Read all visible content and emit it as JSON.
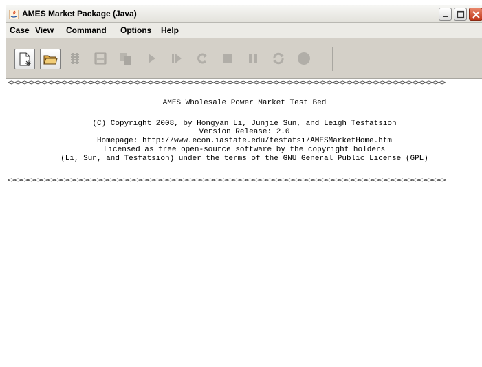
{
  "window": {
    "title": "AMES Market Package (Java)",
    "controls": {
      "minimize_icon": "minimize-icon",
      "maximize_icon": "maximize-icon",
      "close_icon": "close-icon"
    }
  },
  "menu": {
    "items": [
      {
        "accel": "C",
        "rest": "ase"
      },
      {
        "accel": "V",
        "rest": "iew"
      },
      {
        "pre": "Co",
        "accel": "m",
        "rest": "mand"
      },
      {
        "accel": "O",
        "rest": "ptions"
      },
      {
        "accel": "H",
        "rest": "elp"
      }
    ]
  },
  "toolbar": {
    "buttons": [
      {
        "icon": "new-case-icon",
        "enabled": true
      },
      {
        "icon": "open-folder-icon",
        "enabled": true
      },
      {
        "icon": "settings-icon",
        "enabled": false
      },
      {
        "icon": "save-icon",
        "enabled": false
      },
      {
        "icon": "copy-icon",
        "enabled": false
      },
      {
        "icon": "play-icon",
        "enabled": false
      },
      {
        "icon": "step-icon",
        "enabled": false
      },
      {
        "icon": "refresh-icon",
        "enabled": false
      },
      {
        "icon": "stop-icon",
        "enabled": false
      },
      {
        "icon": "pause-icon",
        "enabled": false
      },
      {
        "icon": "reset-icon",
        "enabled": false
      },
      {
        "icon": "record-icon",
        "enabled": false
      }
    ]
  },
  "console": {
    "separator": "<><><><><><><><><><><><><><><><><><><><><><><><><><><><><><><><><><><><><><><><><><><><><><><><><><><><><><><><><><><><><><><><><><>",
    "lines": {
      "title": "AMES Wholesale Power Market Test Bed",
      "copyright": "(C) Copyright 2008, by Hongyan Li, Junjie Sun, and Leigh Tesfatsion",
      "version": "Version Release: 2.0",
      "homepage": "Homepage: http://www.econ.iastate.edu/tesfatsi/AMESMarketHome.htm",
      "license1": "Licensed as free open-source software by the copyright holders",
      "license2": "(Li, Sun, and Tesfatsion) under the terms of the GNU General Public License (GPL)"
    }
  },
  "colors": {
    "chrome": "#d4d0c8",
    "titlebar": "#eceae4",
    "close_button": "#c1391c",
    "console_bg": "#ffffff"
  }
}
